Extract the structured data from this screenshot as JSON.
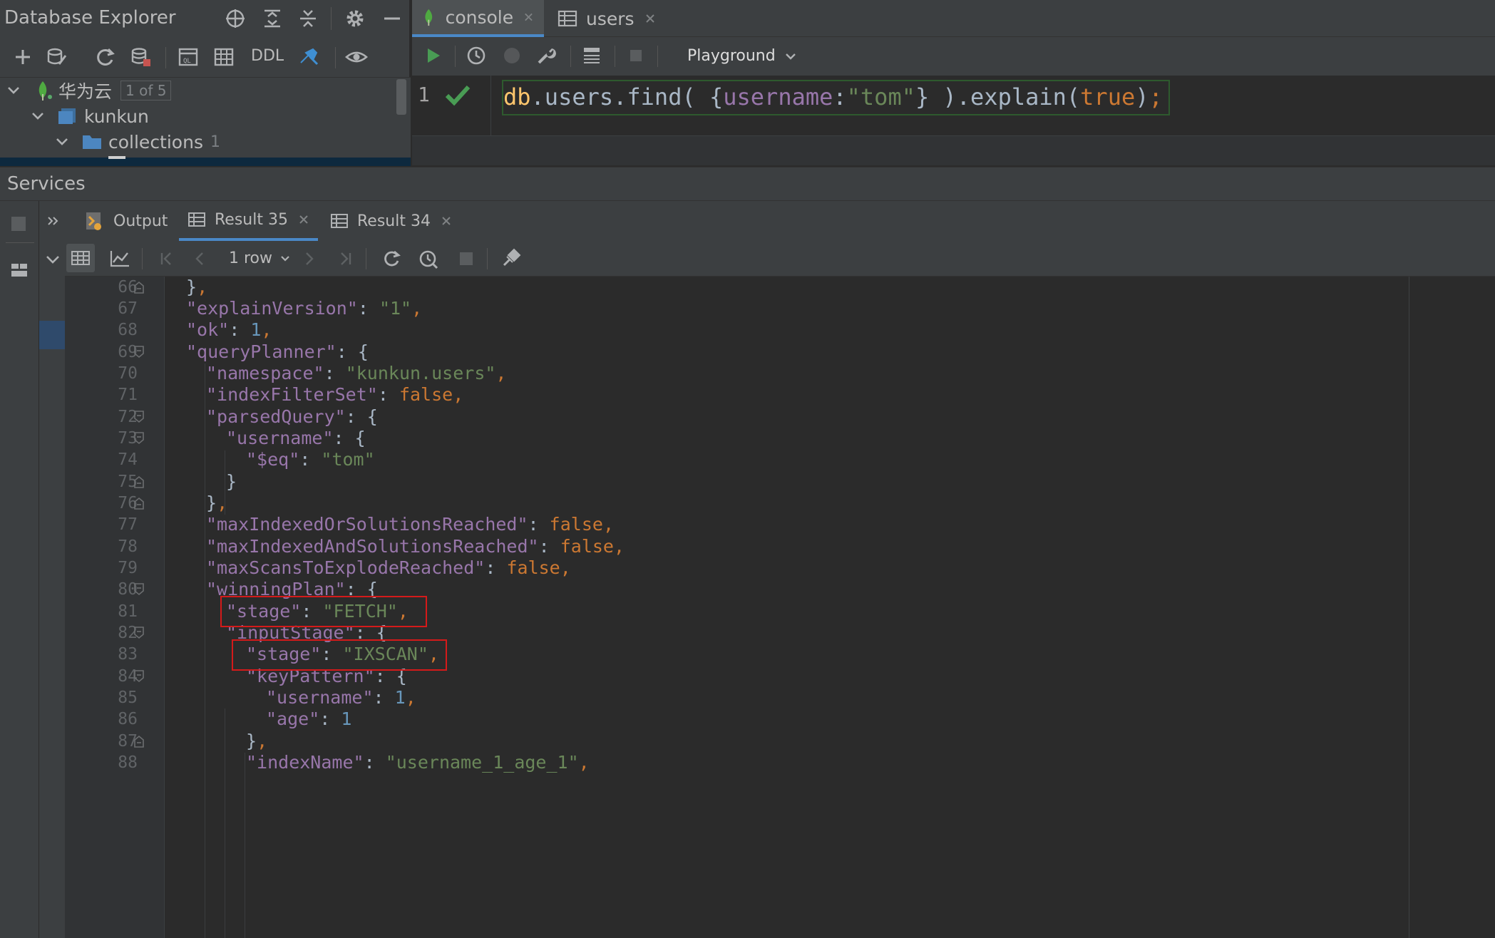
{
  "db_explorer": {
    "title": "Database Explorer",
    "toolbar": {
      "ddl_label": "DDL"
    },
    "tree": {
      "root_label": "华为云",
      "root_badge": "1 of 5",
      "schema_label": "kunkun",
      "folder_label": "collections",
      "folder_count": "1"
    }
  },
  "editor": {
    "tabs": [
      {
        "label": "console",
        "active": true
      },
      {
        "label": "users",
        "active": false
      }
    ],
    "toolbar": {
      "session_label": "Playground"
    },
    "code": {
      "line_number": "1",
      "tokens": [
        "db",
        ".",
        "users",
        ".",
        "find",
        "( ",
        "{",
        "username",
        ":",
        "\"tom\"",
        "}",
        " )",
        ".",
        "explain",
        "(",
        "true",
        ")",
        ";"
      ]
    }
  },
  "services": {
    "title": "Services",
    "tabs": [
      {
        "label": "Output"
      },
      {
        "label": "Result 35",
        "active": true
      },
      {
        "label": "Result 34"
      }
    ],
    "toolbar": {
      "row_count": "1 row"
    },
    "code_lines": [
      {
        "n": "66",
        "text": "},"
      },
      {
        "n": "67",
        "text": "\"explainVersion\": \"1\","
      },
      {
        "n": "68",
        "text": "\"ok\": 1,"
      },
      {
        "n": "69",
        "text": "\"queryPlanner\": {"
      },
      {
        "n": "70",
        "text": "\"namespace\": \"kunkun.users\","
      },
      {
        "n": "71",
        "text": "\"indexFilterSet\": false,"
      },
      {
        "n": "72",
        "text": "\"parsedQuery\": {"
      },
      {
        "n": "73",
        "text": "\"username\": {"
      },
      {
        "n": "74",
        "text": "\"$eq\": \"tom\""
      },
      {
        "n": "75",
        "text": "}"
      },
      {
        "n": "76",
        "text": "},"
      },
      {
        "n": "77",
        "text": "\"maxIndexedOrSolutionsReached\": false,"
      },
      {
        "n": "78",
        "text": "\"maxIndexedAndSolutionsReached\": false,"
      },
      {
        "n": "79",
        "text": "\"maxScansToExplodeReached\": false,"
      },
      {
        "n": "80",
        "text": "\"winningPlan\": {"
      },
      {
        "n": "81",
        "text": "\"stage\": \"FETCH\","
      },
      {
        "n": "82",
        "text": "\"inputStage\": {"
      },
      {
        "n": "83",
        "text": "\"stage\": \"IXSCAN\","
      },
      {
        "n": "84",
        "text": "\"keyPattern\": {"
      },
      {
        "n": "85",
        "text": "\"username\": 1,"
      },
      {
        "n": "86",
        "text": "\"age\": 1"
      },
      {
        "n": "87",
        "text": "},"
      },
      {
        "n": "88",
        "text": "\"indexName\": \"username_1_age_1\","
      }
    ]
  },
  "colors": {
    "accent": "#4a88c7",
    "highlight_box": "#d51a1a",
    "key": "#9876aa",
    "string": "#6a8759",
    "number": "#6897bb",
    "keyword": "#cc7832"
  }
}
